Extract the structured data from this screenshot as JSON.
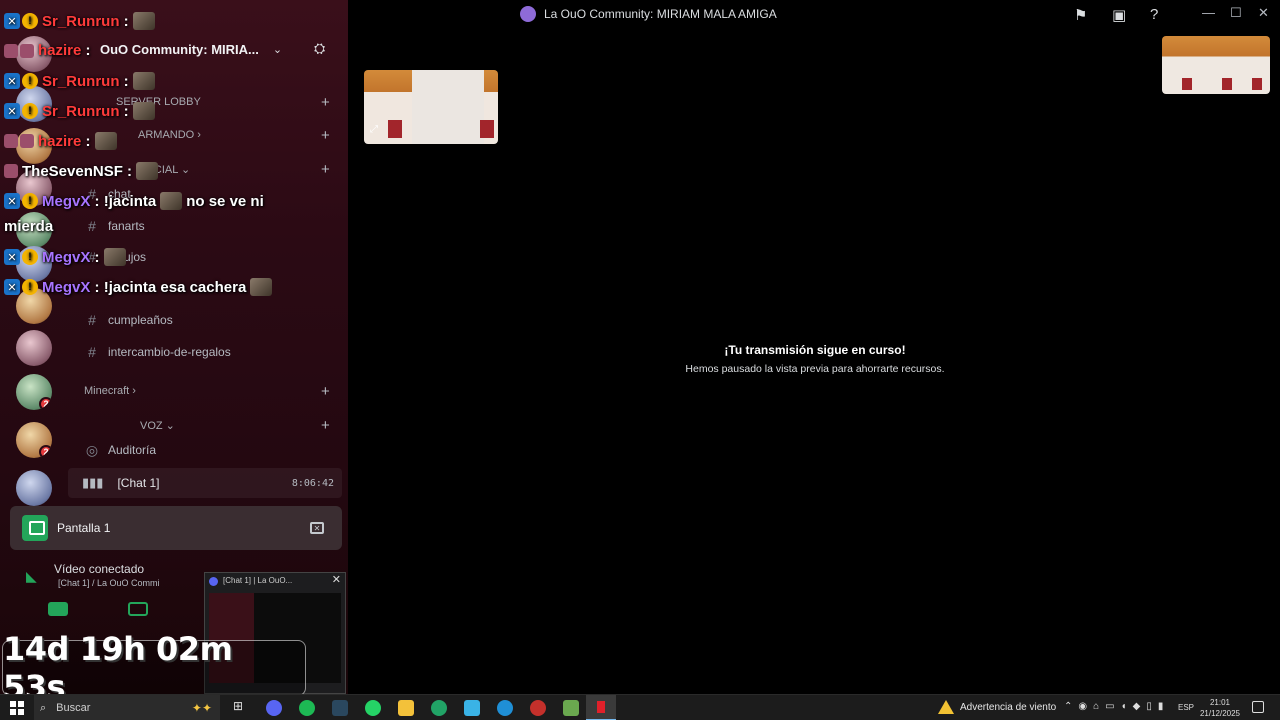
{
  "window": {
    "title": "La OuO Community: MIRIAM MALA AMIGA"
  },
  "server": {
    "name": "OuO Community: MIRIA...",
    "categories": [
      {
        "label": "SERVER LOBBY"
      },
      {
        "label": "ARMANDO"
      },
      {
        "label": "SOCIAL"
      },
      {
        "label": "Minecraft"
      },
      {
        "label": "VOZ"
      }
    ],
    "channels": [
      {
        "name": "chat"
      },
      {
        "name": "fanarts"
      },
      {
        "name": "dibujos"
      },
      {
        "name": "cumpleaños"
      },
      {
        "name": "intercambio-de-regalos"
      },
      {
        "name": "Auditoría"
      }
    ],
    "guild_badges": [
      "2",
      "2"
    ]
  },
  "voice": {
    "channel": "[Chat 1]",
    "timer": "8:06:42"
  },
  "screen_share": {
    "label": "Pantalla 1"
  },
  "video_status": {
    "title": "Vídeo conectado",
    "sub": "[Chat 1] / La OuO Commi"
  },
  "popup": {
    "title": "[Chat 1] | La OuO..."
  },
  "chat": [
    {
      "user": "Sr_Runrun",
      "color": "red",
      "text": ""
    },
    {
      "user": "hazire",
      "color": "red",
      "text": ""
    },
    {
      "user": "Sr_Runrun",
      "color": "red",
      "text": ""
    },
    {
      "user": "Sr_Runrun",
      "color": "red",
      "text": ""
    },
    {
      "user": "hazire",
      "color": "red",
      "text": ""
    },
    {
      "user": "TheSevenNSF",
      "color": "white",
      "text": ""
    },
    {
      "user": "MegvX",
      "color": "purple",
      "text": "!jacinta",
      "text2": "no se ve ni",
      "text3": "mierda"
    },
    {
      "user": "MegvX",
      "color": "purple",
      "text": ""
    },
    {
      "user": "MegvX",
      "color": "purple",
      "text": "!jacinta esa cachera"
    }
  ],
  "uptime": "14d 19h 02m 53s",
  "stream": {
    "paused_title": "¡Tu transmisión sigue en curso!",
    "paused_sub": "Hemos pausado la vista previa para ahorrarte recursos."
  },
  "taskbar": {
    "search": "Buscar",
    "weather": "Advertencia de viento",
    "lang": "ESP",
    "time": "21:01",
    "date": "21/12/2025"
  },
  "colors": {
    "online": "#23a55a",
    "mention_red": "#ff3b3b",
    "purple": "#a874ff",
    "accent": "#5865f2"
  }
}
